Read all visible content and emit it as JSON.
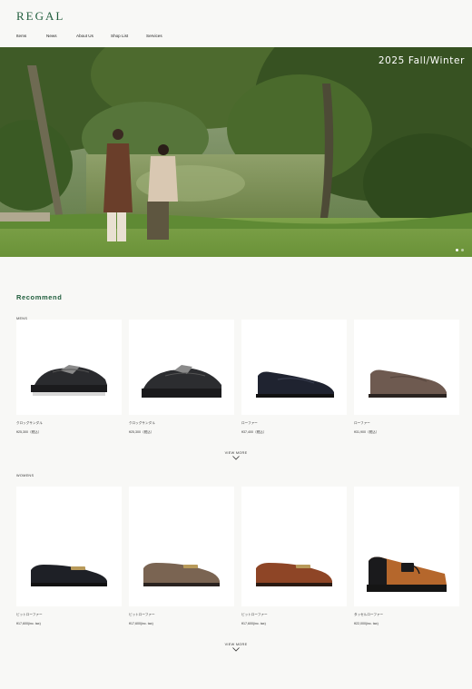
{
  "brand": {
    "logo": "REGAL"
  },
  "nav": {
    "items": [
      "Items",
      "News",
      "About Us",
      "Shop List",
      "Services"
    ]
  },
  "hero": {
    "title": "2025 Fall/Winter",
    "slides": 2,
    "active_slide": 1
  },
  "recommend": {
    "title": "Recommend",
    "mens": {
      "label": "MENS",
      "items": [
        {
          "name": "クロッグサンダル",
          "price": "¥25,300（税込）"
        },
        {
          "name": "クロッグサンダル",
          "price": "¥25,300（税込）"
        },
        {
          "name": "ローファー",
          "price": "¥37,400（税込）"
        },
        {
          "name": "ローファー",
          "price": "¥31,900（税込）"
        }
      ],
      "view_more": "VIEW MORE"
    },
    "womens": {
      "label": "WOMENS",
      "items": [
        {
          "name": "ビットローファー",
          "price": "¥17,600(inc. tax)"
        },
        {
          "name": "ビットローファー",
          "price": "¥17,600(inc. tax)"
        },
        {
          "name": "ビットローファー",
          "price": "¥17,600(inc. tax)"
        },
        {
          "name": "タッセルローファー",
          "price": "¥22,000(inc. tax)"
        }
      ],
      "view_more": "VIEW MORE"
    }
  },
  "colors": {
    "brand_green": "#1f5d3c",
    "background": "#f8f8f6"
  }
}
